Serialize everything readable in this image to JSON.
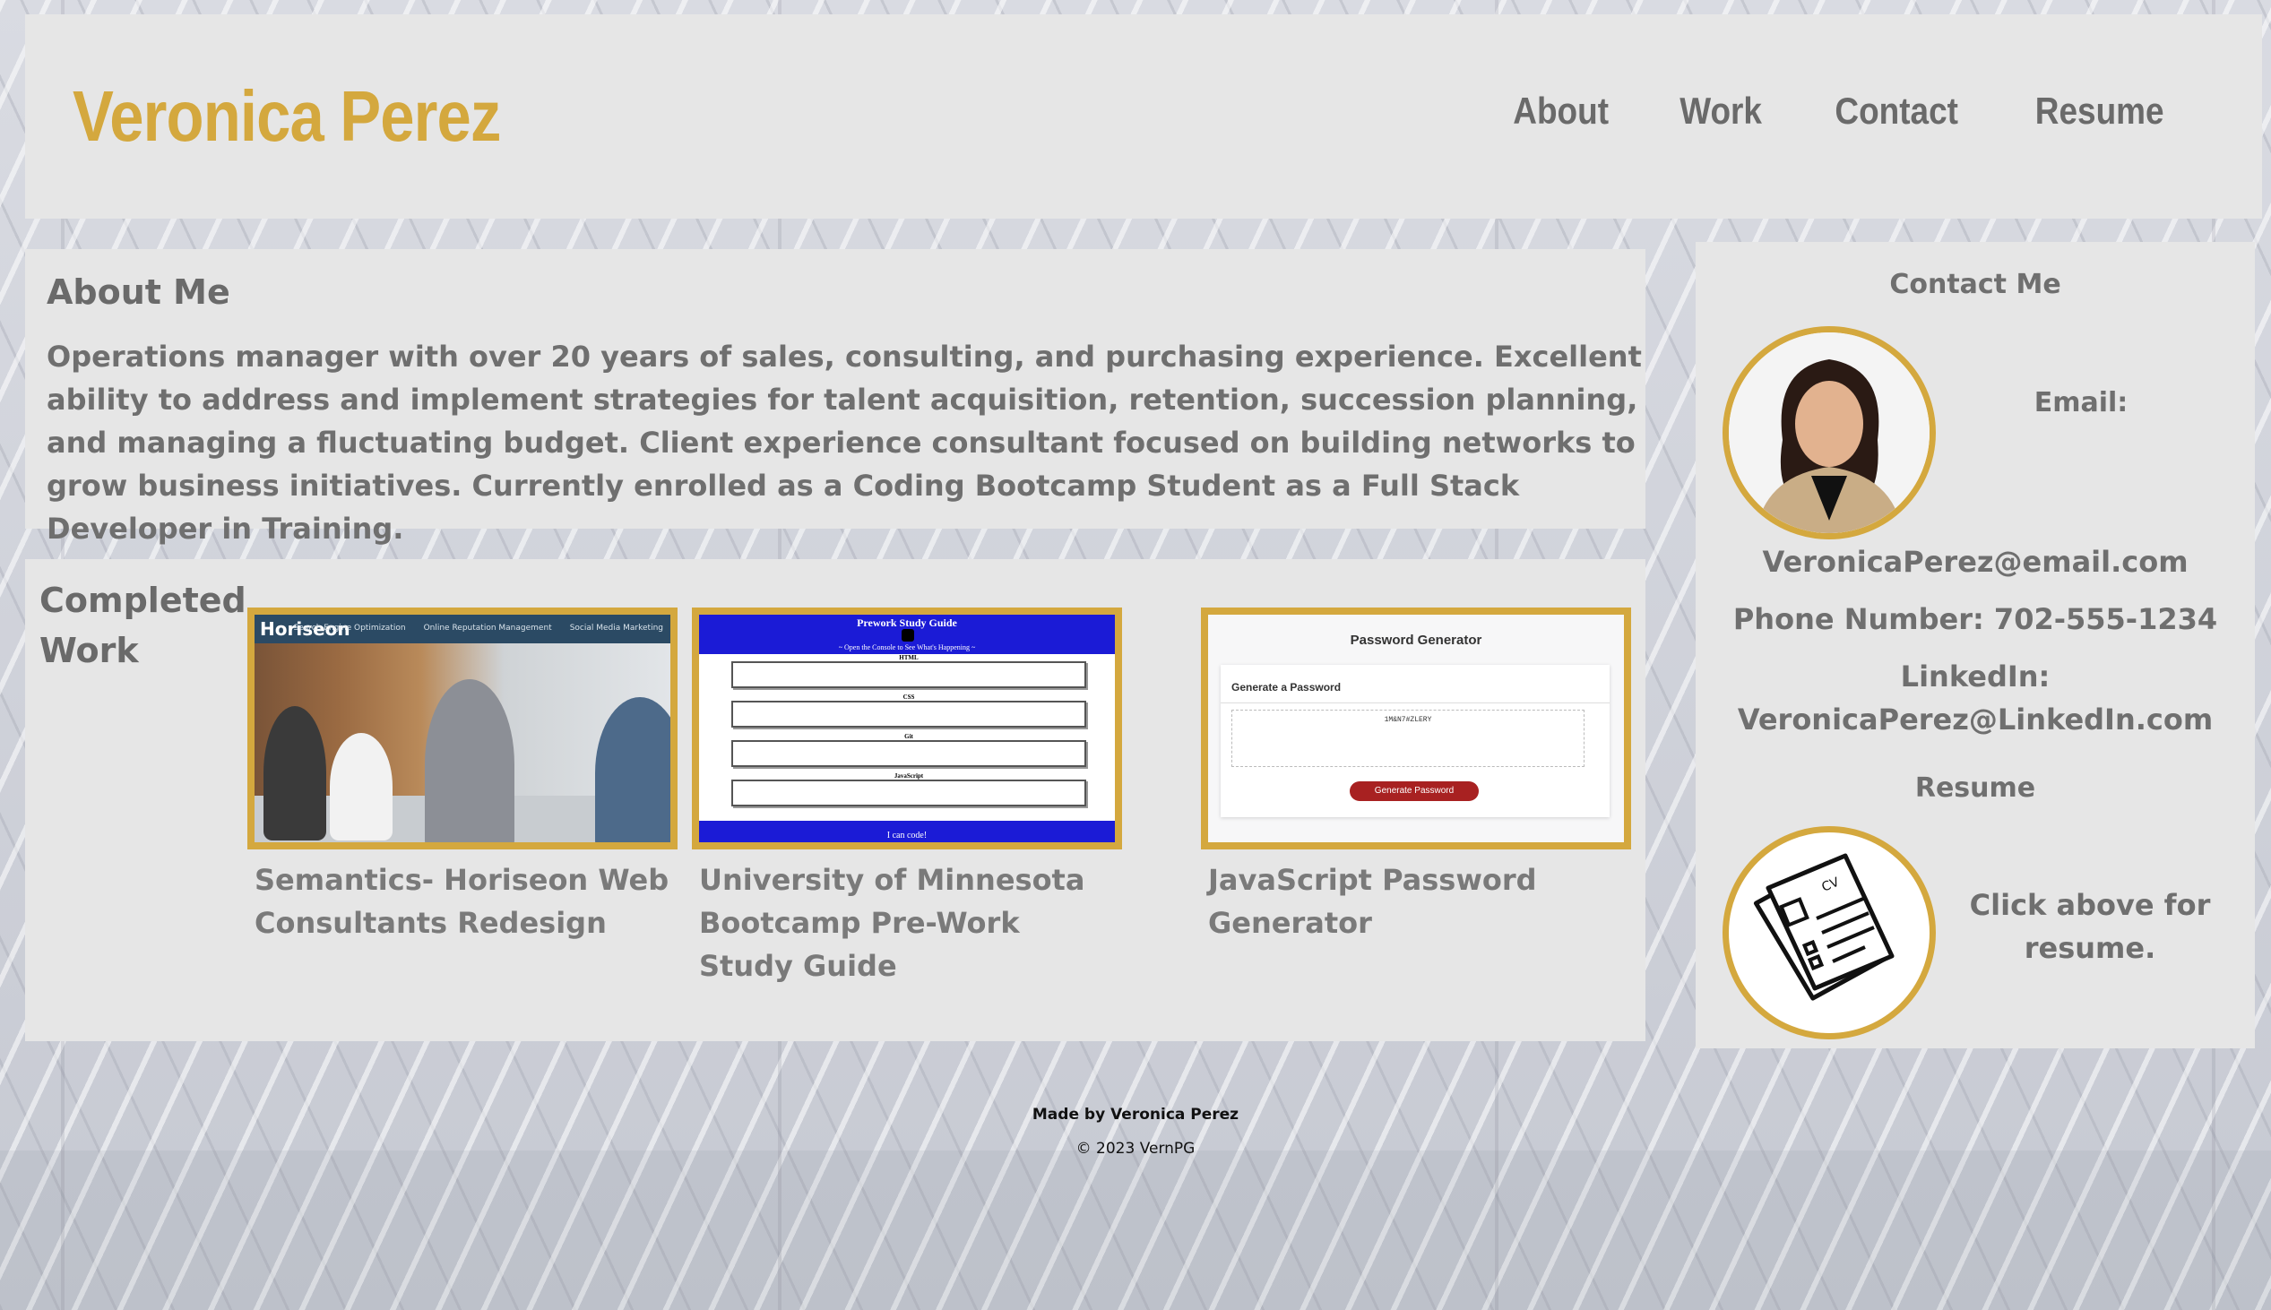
{
  "header": {
    "brand": "Veronica Perez",
    "nav": [
      "About",
      "Work",
      "Contact",
      "Resume"
    ]
  },
  "about": {
    "heading": "About Me",
    "text": "Operations manager with over 20 years of sales, consulting, and purchasing experience. Excellent ability to address and implement strategies for talent acquisition, retention, succession planning, and managing a fluctuating budget. Client experience consultant focused on building networks to grow business initiatives. Currently enrolled as a Coding Bootcamp Student as a Full Stack Developer in Training."
  },
  "work": {
    "heading": "Completed Work",
    "projects": [
      {
        "caption": "Semantics- Horiseon Web Consultants Redesign",
        "thumb": {
          "logo": "Horiseon",
          "nav": [
            "Search Engine Optimization",
            "Online Reputation Management",
            "Social Media Marketing"
          ]
        }
      },
      {
        "caption": "University of Minnesota Bootcamp Pre-Work Study Guide",
        "thumb": {
          "title": "Prework Study Guide",
          "subtitle": "~ Open the Console to See What's Happening ~",
          "sections": [
            "HTML",
            "CSS",
            "Git",
            "JavaScript"
          ],
          "footer": "I can code!"
        }
      },
      {
        "caption": "JavaScript Password Generator",
        "thumb": {
          "title": "Password Generator",
          "panel_title": "Generate a Password",
          "password": "1M&N7#ZLERY",
          "button": "Generate Password"
        }
      }
    ]
  },
  "contact": {
    "heading": "Contact Me",
    "email_label": "Email:",
    "email": "VeronicaPerez@email.com",
    "phone": "Phone Number: 702-555-1234",
    "linkedin_label": "LinkedIn:",
    "linkedin": "VeronicaPerez@LinkedIn.com",
    "resume_heading": "Resume",
    "resume_hint": "Click above for resume.",
    "resume_icon_text": "CV"
  },
  "footer": {
    "made_by": "Made by Veronica Perez",
    "copyright": "© 2023 VernPG"
  },
  "colors": {
    "accent": "#d4a83e",
    "panel": "#e6e6e6",
    "text": "#6f6f6f"
  }
}
